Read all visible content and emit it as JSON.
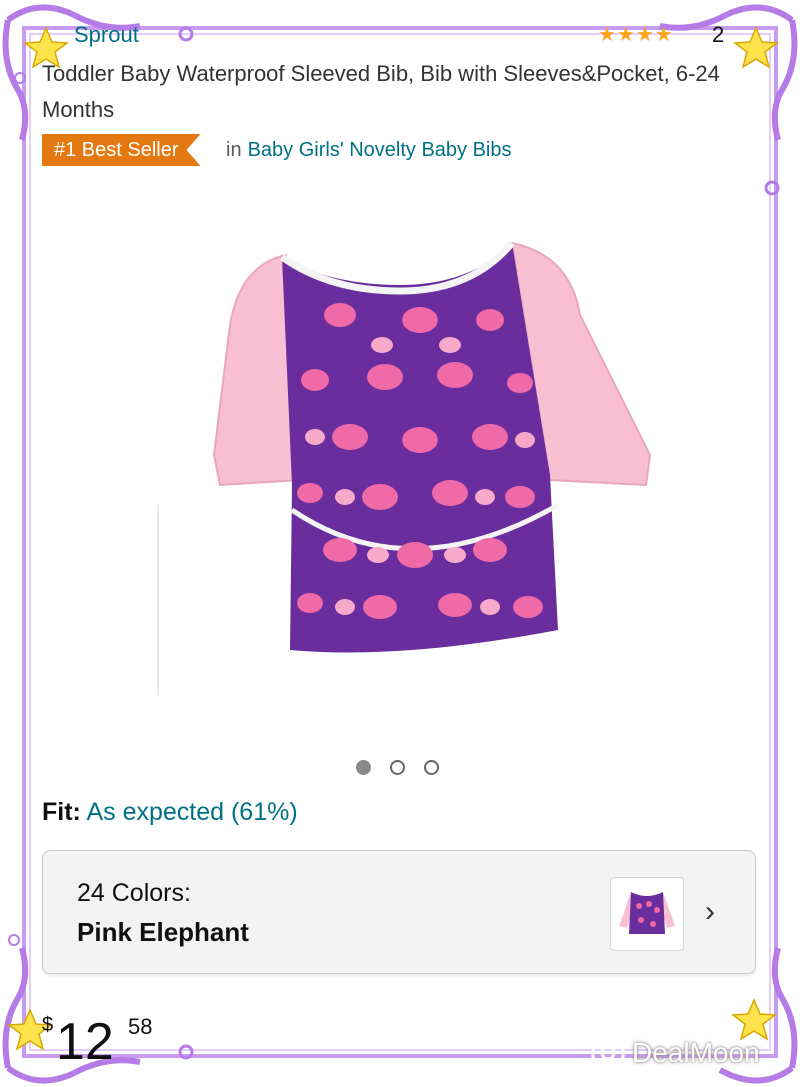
{
  "product": {
    "brand": "Sprout",
    "rating_stars": "★★★★",
    "rating_count": "2",
    "title": "Toddler Baby Waterproof Sleeved Bib, Bib with Sleeves&Pocket, 6-24 Months",
    "badge": "#1 Best Seller",
    "category_prefix": "in",
    "category": "Baby Girls' Novelty Baby Bibs"
  },
  "carousel": {
    "count": 3,
    "active_index": 0
  },
  "fit": {
    "label": "Fit:",
    "value": "As expected (61%)"
  },
  "variation": {
    "count_label": "24 Colors:",
    "selected": "Pink Elephant"
  },
  "price": {
    "currency": "$",
    "whole": "12",
    "fraction": "58"
  },
  "watermark": "DealMoon",
  "colors": {
    "link": "#007185",
    "badge": "#e47911",
    "frame": "#b57be6",
    "sleeve": "#f8bfd2",
    "body": "#6a2d9e",
    "elephant": "#f06aa8"
  }
}
